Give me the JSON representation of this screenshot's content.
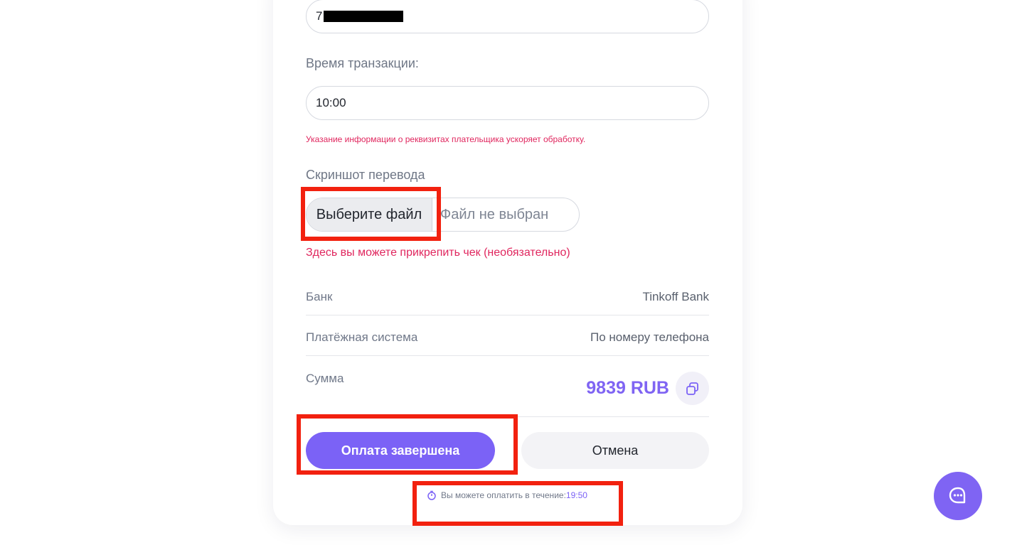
{
  "form": {
    "phone_prefix": "7",
    "time_label": "Время транзакции:",
    "time_value": "10:00",
    "payer_hint": "Указание информации о реквизитах плательщика ускоряет обработку.",
    "screenshot_label": "Скриншот перевода",
    "file_button": "Выберите файл",
    "file_status": "Файл не выбран",
    "attach_hint": "Здесь вы можете прикрепить чек (необязательно)"
  },
  "details": [
    {
      "label": "Банк",
      "value": "Tinkoff Bank"
    },
    {
      "label": "Платёжная система",
      "value": "По номеру телефона"
    },
    {
      "label": "Сумма",
      "value": "9839 RUB"
    }
  ],
  "actions": {
    "confirm": "Оплата завершена",
    "cancel": "Отмена"
  },
  "timer": {
    "text": "Вы можете оплатить в течение:",
    "value": "19:50"
  },
  "icons": {
    "copy": "copy-icon",
    "timer": "stopwatch-icon",
    "chat": "chat-icon"
  },
  "colors": {
    "accent": "#7b62f6",
    "hint_red": "#e0265e",
    "highlight": "#f2210f"
  }
}
